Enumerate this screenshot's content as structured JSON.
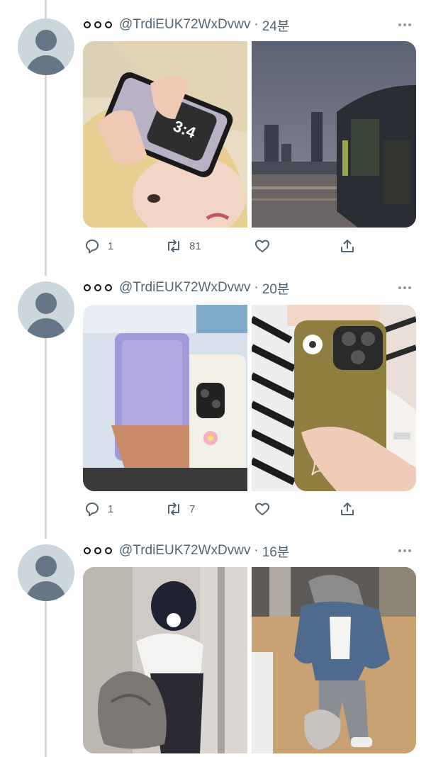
{
  "tweets": [
    {
      "handle": "@TrdiEUK72WxDvwv",
      "time": "24분",
      "replies": "1",
      "retweets": "81",
      "likes": "",
      "media": [
        {
          "description": "selfie with phone",
          "colors": [
            "#d8c7a6",
            "#ead7b8"
          ]
        },
        {
          "description": "city at dusk with bus",
          "colors": [
            "#5b6373",
            "#3a3f4a"
          ]
        }
      ]
    },
    {
      "handle": "@TrdiEUK72WxDvwv",
      "time": "20분",
      "replies": "1",
      "retweets": "7",
      "likes": "",
      "media": [
        {
          "description": "purple phone case mirror selfie",
          "colors": [
            "#c9d9e8",
            "#8f86c9"
          ]
        },
        {
          "description": "olive phone case mirror selfie",
          "colors": [
            "#e4dcd3",
            "#8e7e3e"
          ]
        }
      ]
    },
    {
      "handle": "@TrdiEUK72WxDvwv",
      "time": "16분",
      "replies": "",
      "retweets": "",
      "likes": "",
      "media": [
        {
          "description": "mirror selfie white top",
          "colors": [
            "#c8c4c0",
            "#6f6c6a"
          ]
        },
        {
          "description": "mirror selfie denim jacket",
          "colors": [
            "#a7936f",
            "#4e5d72"
          ]
        }
      ]
    }
  ],
  "icons": {
    "reply": "reply-icon",
    "retweet": "retweet-icon",
    "like": "heart-icon",
    "share": "share-icon",
    "more": "more-icon"
  }
}
